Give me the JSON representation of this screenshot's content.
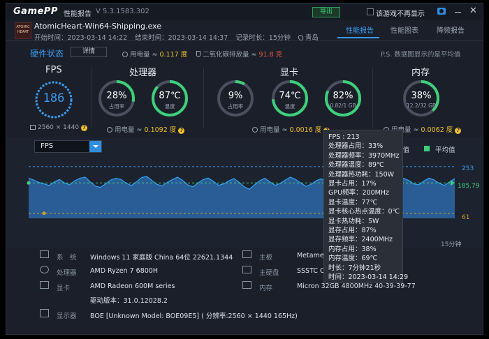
{
  "titlebar": {
    "logo": "GamePP",
    "title": "性能报告",
    "version": "V 5.3.1583.302",
    "export_label": "导出",
    "checkbox_label": "该游戏不再显示"
  },
  "game": {
    "thumb_text": "ATOMIC HEART",
    "name": "AtomicHeart-Win64-Shipping.exe",
    "start": "开始时间：2023-03-14 14:22",
    "end": "结束时间：2023-03-14 14:37",
    "duration": "记录时长：15分钟",
    "location": "青岛"
  },
  "tabs": [
    "性能报告",
    "性能图表",
    "降频报告"
  ],
  "hardware": {
    "title": "硬件状态",
    "detail_label": "详情",
    "power_label": "用电量 ≈ ",
    "power_value": "0.117 度",
    "carbon_label": "二氧化碳排放量 ≈ ",
    "carbon_value": "91.8 克",
    "note": "P.S. 数据图显示的是平均值"
  },
  "fps": {
    "title": "FPS",
    "value": "186",
    "resolution": "2560 × 1440"
  },
  "cpu": {
    "title": "处理器",
    "usage": {
      "value": "28%",
      "label": "占用率",
      "fraction": 0.28
    },
    "temp": {
      "value": "87℃",
      "label": "温度",
      "fraction": 0.87
    },
    "power_label": "用电量 ≈ ",
    "power_value": "0.1092 度"
  },
  "gpu": {
    "title": "显卡",
    "usage": {
      "value": "9%",
      "label": "占用率",
      "fraction": 0.09
    },
    "temp": {
      "value": "74℃",
      "label": "温度",
      "fraction": 0.74
    },
    "vram": {
      "value": "82%",
      "label": "0.82/1 GB",
      "fraction": 0.82
    },
    "power_label": "用电量 ≈ ",
    "power_value": "0.0016 度"
  },
  "memory": {
    "title": "内存",
    "usage": {
      "value": "38%",
      "label": "12.2/32 GB",
      "fraction": 0.38
    },
    "power_label": "用电量 ≈ ",
    "power_value": "0.0062 度"
  },
  "chart_controls": {
    "select_value": "FPS",
    "legend_min": "小值",
    "legend_avg": "平均值",
    "time_label": "15分钟"
  },
  "chart_data": {
    "type": "area",
    "series": [
      {
        "name": "FPS",
        "values": [
          205,
          198,
          188,
          182,
          175,
          190,
          200,
          186,
          178,
          195,
          205,
          210,
          190,
          172,
          168,
          182,
          198,
          205,
          200,
          185,
          175,
          190,
          208,
          213,
          196,
          180,
          174,
          188,
          200,
          210,
          196,
          178,
          170,
          186,
          200,
          206,
          192,
          176,
          182,
          195,
          204,
          188,
          170,
          160,
          178,
          195,
          205,
          190,
          176,
          184,
          198,
          210,
          200,
          186,
          172,
          180,
          195,
          203,
          192,
          178,
          184,
          196,
          210,
          218,
          240,
          205,
          180,
          192,
          205,
          198,
          186,
          176,
          190,
          205,
          196,
          182,
          178,
          194,
          206,
          198,
          184,
          176,
          190,
          204
        ]
      }
    ],
    "y_ticks": [
      253,
      185.79,
      61
    ],
    "ylim": [
      40,
      270
    ],
    "colors": {
      "max": "#3a9bf0",
      "avg": "#3ecf7a",
      "min": "#c9a227",
      "area": "#2f72b8",
      "line": "#2fa4f7"
    }
  },
  "tooltip": [
    "FPS : 213",
    "处理器占用：33%",
    "处理器频率：3970MHz",
    "处理器温度：89℃",
    "处理器热功耗：150W",
    "显卡占用：17%",
    "GPU频率：200MHz",
    "显卡温度：77℃",
    "显卡核心热点温度：0℃",
    "显卡热功耗：5W",
    "显存占用：87%",
    "显存频率：2400MHz",
    "内存占用：38%",
    "内存温度：69℃",
    "时长：7分钟21秒",
    "时间：2023-03-14 14:29"
  ],
  "system": {
    "os_key": "系　统",
    "os_val": "Windows 11 家庭版 China 64位 22621.1344",
    "cpu_key": "处理器",
    "cpu_val": "AMD Ryzen 7 6800H",
    "gpu_key": "显卡",
    "gpu_val": "AMD Radeon 600M series",
    "driver_val": "驱动版本：31.0.12028.2",
    "display_key": "显示器",
    "display_val": "BOE [Unknown Model: BOE09E5] ( 分辨率:2560 × 1440 165Hz)",
    "board_key": "主板",
    "board_val": "Metame",
    "disk_key": "主硬盘",
    "disk_val": "SSSTC C",
    "mem_key": "内存",
    "mem_val": "Micron 32GB 4800MHz 40-39-39-77"
  }
}
